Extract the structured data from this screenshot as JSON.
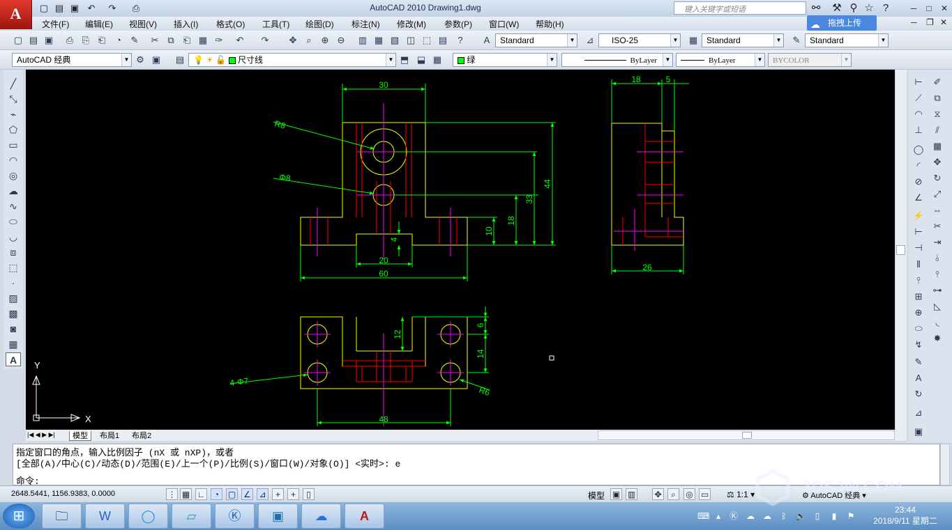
{
  "app": {
    "logo_letter": "A",
    "title": "AutoCAD 2010    Drawing1.dwg",
    "search_placeholder": "键入关键字或短语",
    "upload_label": "拖拽上传"
  },
  "menu": [
    "文件(F)",
    "编辑(E)",
    "视图(V)",
    "插入(I)",
    "格式(O)",
    "工具(T)",
    "绘图(D)",
    "标注(N)",
    "修改(M)",
    "参数(P)",
    "窗口(W)",
    "帮助(H)"
  ],
  "styles_toolbar": {
    "text_style": "Standard",
    "dim_style": "ISO-25",
    "table_style": "Standard",
    "multileader_style": "Standard"
  },
  "layers_toolbar": {
    "workspace": "AutoCAD 经典",
    "layer": "尺寸线",
    "color": "绿",
    "linetype": "ByLayer",
    "lineweight": "ByLayer",
    "plotstyle": "BYCOLOR"
  },
  "drawing": {
    "dims": {
      "front_width_top": "30",
      "front_radius": "R8",
      "front_hole": "Φ8",
      "front_h44": "44",
      "front_h33": "33",
      "front_h18": "18",
      "front_h10": "10",
      "front_h4": "4",
      "front_w20": "20",
      "front_w60": "60",
      "side_w18": "18",
      "side_w5": "5",
      "side_w26": "26",
      "top_h12": "12",
      "top_h6": "6",
      "top_h14": "14",
      "top_holes": "4-Φ7",
      "top_radius": "R6",
      "top_w48": "48"
    },
    "ucs": {
      "x": "X",
      "y": "Y"
    },
    "colors": {
      "outline": "#ffff00",
      "dimension": "#00ff00",
      "center": "#ff00ff",
      "hidden": "#ff0000"
    }
  },
  "tabs": {
    "model": "模型",
    "layout1": "布局1",
    "layout2": "布局2"
  },
  "command": {
    "line1": "指定窗口的角点，输入比例因子 (nX 或 nXP)，或者",
    "line2": "[全部(A)/中心(C)/动态(D)/范围(E)/上一个(P)/比例(S)/窗口(W)/对象(O)] <实时>: e",
    "prompt": "命令:"
  },
  "status": {
    "coords": "2648.5441, 1156.9383, 0.0000",
    "model_label": "模型",
    "annotation_scale": "1:1",
    "workspace": "AutoCAD 经典"
  },
  "taskbar": {
    "time": "23:44",
    "date": "2018/9/11 星期二"
  },
  "watermark": "3DSJW.COM"
}
